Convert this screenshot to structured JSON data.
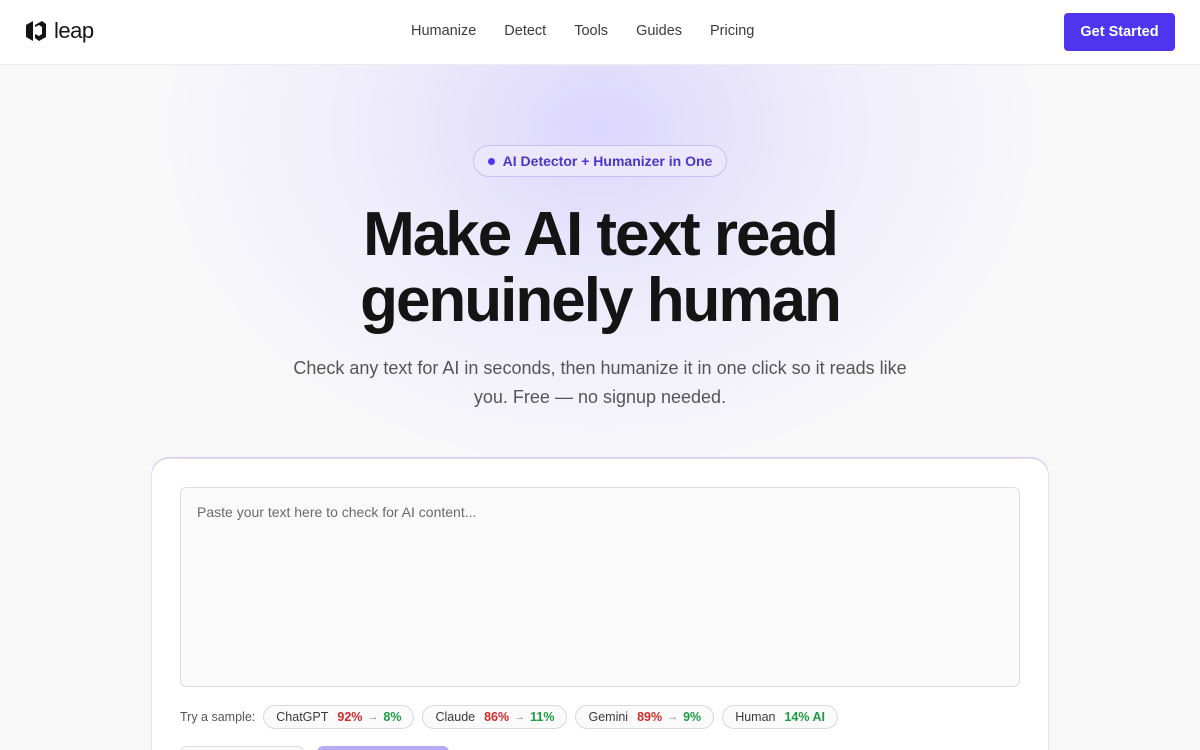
{
  "brand": {
    "name": "leap",
    "accent": "#4f35f0"
  },
  "nav": {
    "items": [
      "Humanize",
      "Detect",
      "Tools",
      "Guides",
      "Pricing"
    ]
  },
  "header": {
    "cta_label": "Get Started"
  },
  "hero": {
    "badge": "AI Detector + Humanizer in One",
    "title_line1": "Make AI text read",
    "title_line2": "genuinely human",
    "subtitle": "Check any text for AI in seconds, then humanize it in one click so it reads like you. Free — no signup needed."
  },
  "editor": {
    "placeholder": "Paste your text here to check for AI content...",
    "value": ""
  },
  "samples": {
    "label": "Try a sample:",
    "items": [
      {
        "name": "ChatGPT",
        "before": "92%",
        "arrow": "→",
        "after": "8%"
      },
      {
        "name": "Claude",
        "before": "86%",
        "arrow": "→",
        "after": "11%"
      },
      {
        "name": "Gemini",
        "before": "89%",
        "arrow": "→",
        "after": "9%"
      },
      {
        "name": "Human",
        "result": "14% AI"
      }
    ]
  },
  "colors": {
    "high_score": "#d12b2b",
    "low_score": "#1f9b43"
  }
}
